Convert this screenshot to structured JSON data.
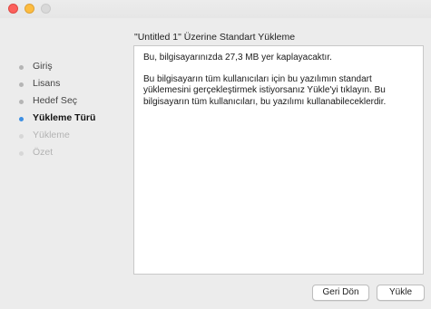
{
  "window": {
    "panel_title": "\"Untitled 1\" Üzerine Standart Yükleme"
  },
  "sidebar": {
    "steps": [
      {
        "label": "Giriş",
        "state": "done"
      },
      {
        "label": "Lisans",
        "state": "done"
      },
      {
        "label": "Hedef Seç",
        "state": "done"
      },
      {
        "label": "Yükleme Türü",
        "state": "active"
      },
      {
        "label": "Yükleme",
        "state": "pending"
      },
      {
        "label": "Özet",
        "state": "pending"
      }
    ]
  },
  "content": {
    "paragraph_1": "Bu, bilgisayarınızda 27,3 MB yer kaplayacaktır.",
    "paragraph_2": "Bu bilgisayarın tüm kullanıcıları için bu yazılımın standart yüklemesini gerçekleştirmek istiyorsanız Yükle'yi tıklayın. Bu bilgisayarın tüm kullanıcıları, bu yazılımı kullanabileceklerdir."
  },
  "buttons": {
    "back_label": "Geri Dön",
    "install_label": "Yükle"
  },
  "colors": {
    "active_step": "#3d8fe3",
    "close_light": "#fc605c",
    "minimize_light": "#fdbc40"
  }
}
